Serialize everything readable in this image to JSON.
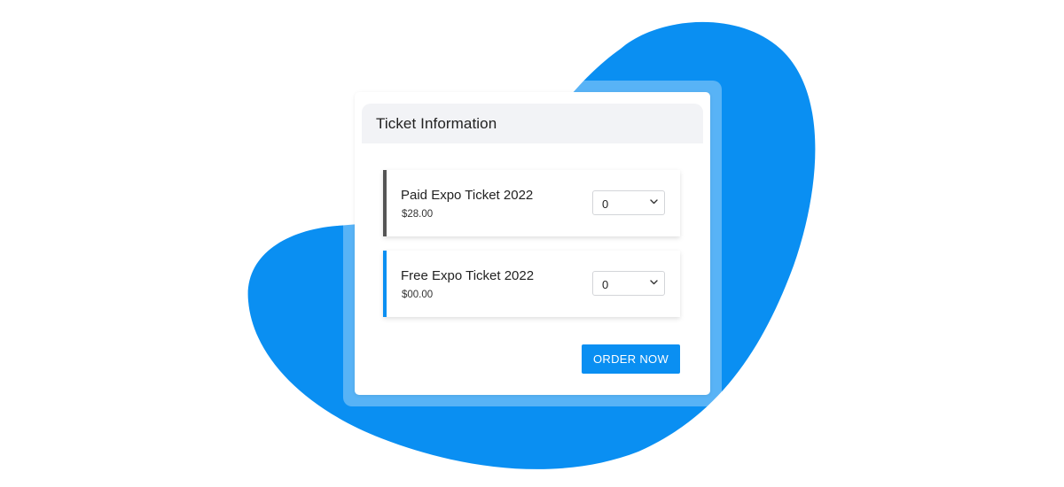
{
  "card": {
    "title": "Ticket Information"
  },
  "tickets": [
    {
      "name": "Paid Expo Ticket 2022",
      "price": "$28.00",
      "quantity": "0"
    },
    {
      "name": "Free Expo Ticket 2022",
      "price": "$00.00",
      "quantity": "0"
    }
  ],
  "order_button_label": "ORDER NOW",
  "colors": {
    "accent": "#0a8ff2",
    "blob": "#0a8ff2",
    "paid_stripe": "#555555",
    "header_bg": "#f2f3f6"
  },
  "icons": {
    "dropdown": "chevron-down-icon"
  }
}
